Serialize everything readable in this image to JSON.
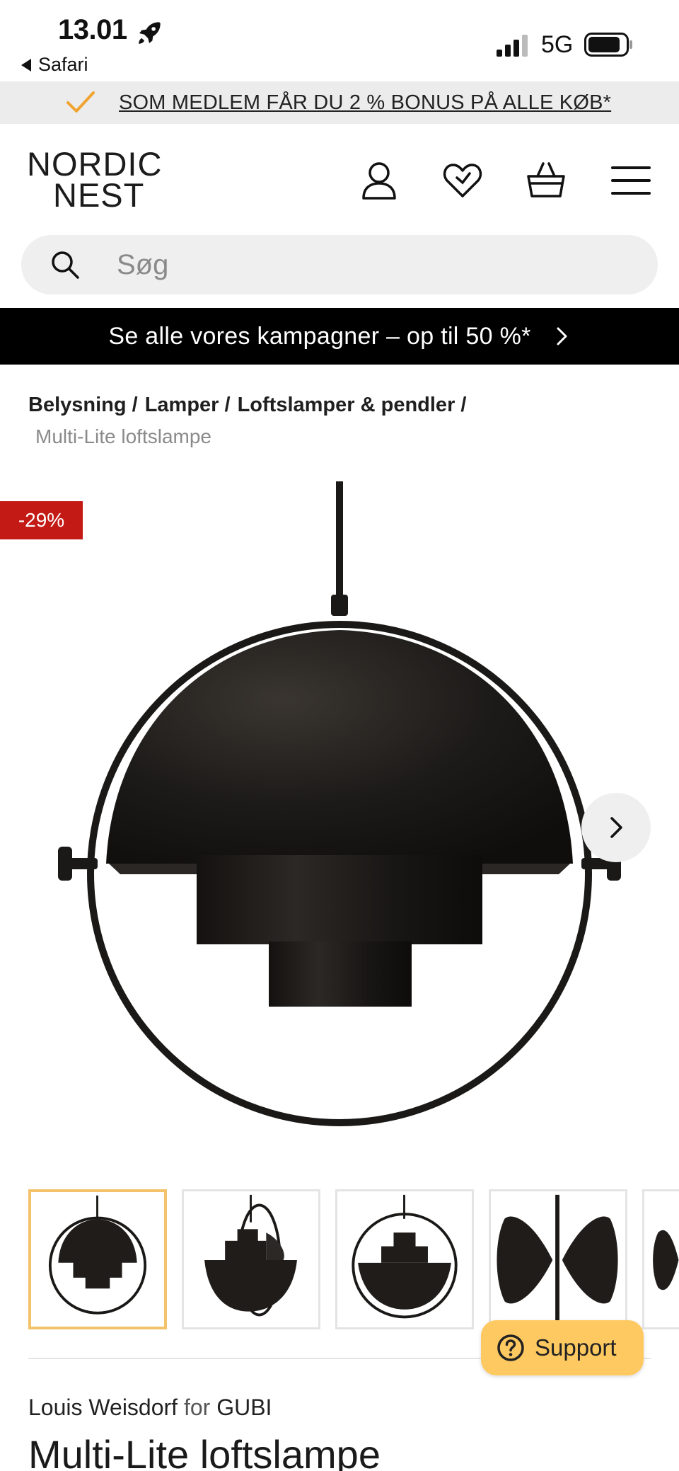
{
  "status_bar": {
    "time": "13.01",
    "back_app": "Safari",
    "network": "5G"
  },
  "promo": {
    "text": "SOM MEDLEM FÅR DU 2 % BONUS PÅ ALLE KØB*",
    "accent_color": "#f0a330"
  },
  "header": {
    "logo_line1": "NORDIC",
    "logo_line2": "NEST",
    "icons": [
      "user-icon",
      "heart-icon",
      "basket-icon",
      "menu-icon"
    ]
  },
  "search": {
    "placeholder": "Søg"
  },
  "campaign": {
    "text": "Se alle vores kampagner – op til 50 %*"
  },
  "breadcrumb": {
    "items": [
      "Belysning /",
      "Lamper /",
      "Loftslamper & pendler /"
    ],
    "current": "Multi-Lite loftslampe"
  },
  "product": {
    "discount_badge": "-29%",
    "discount_color": "#c41a15",
    "designer": "Louis Weisdorf",
    "for_word": "for",
    "brand": "GUBI",
    "title": "Multi-Lite loftslampe"
  },
  "support": {
    "label": "Support",
    "color": "#ffc961"
  }
}
